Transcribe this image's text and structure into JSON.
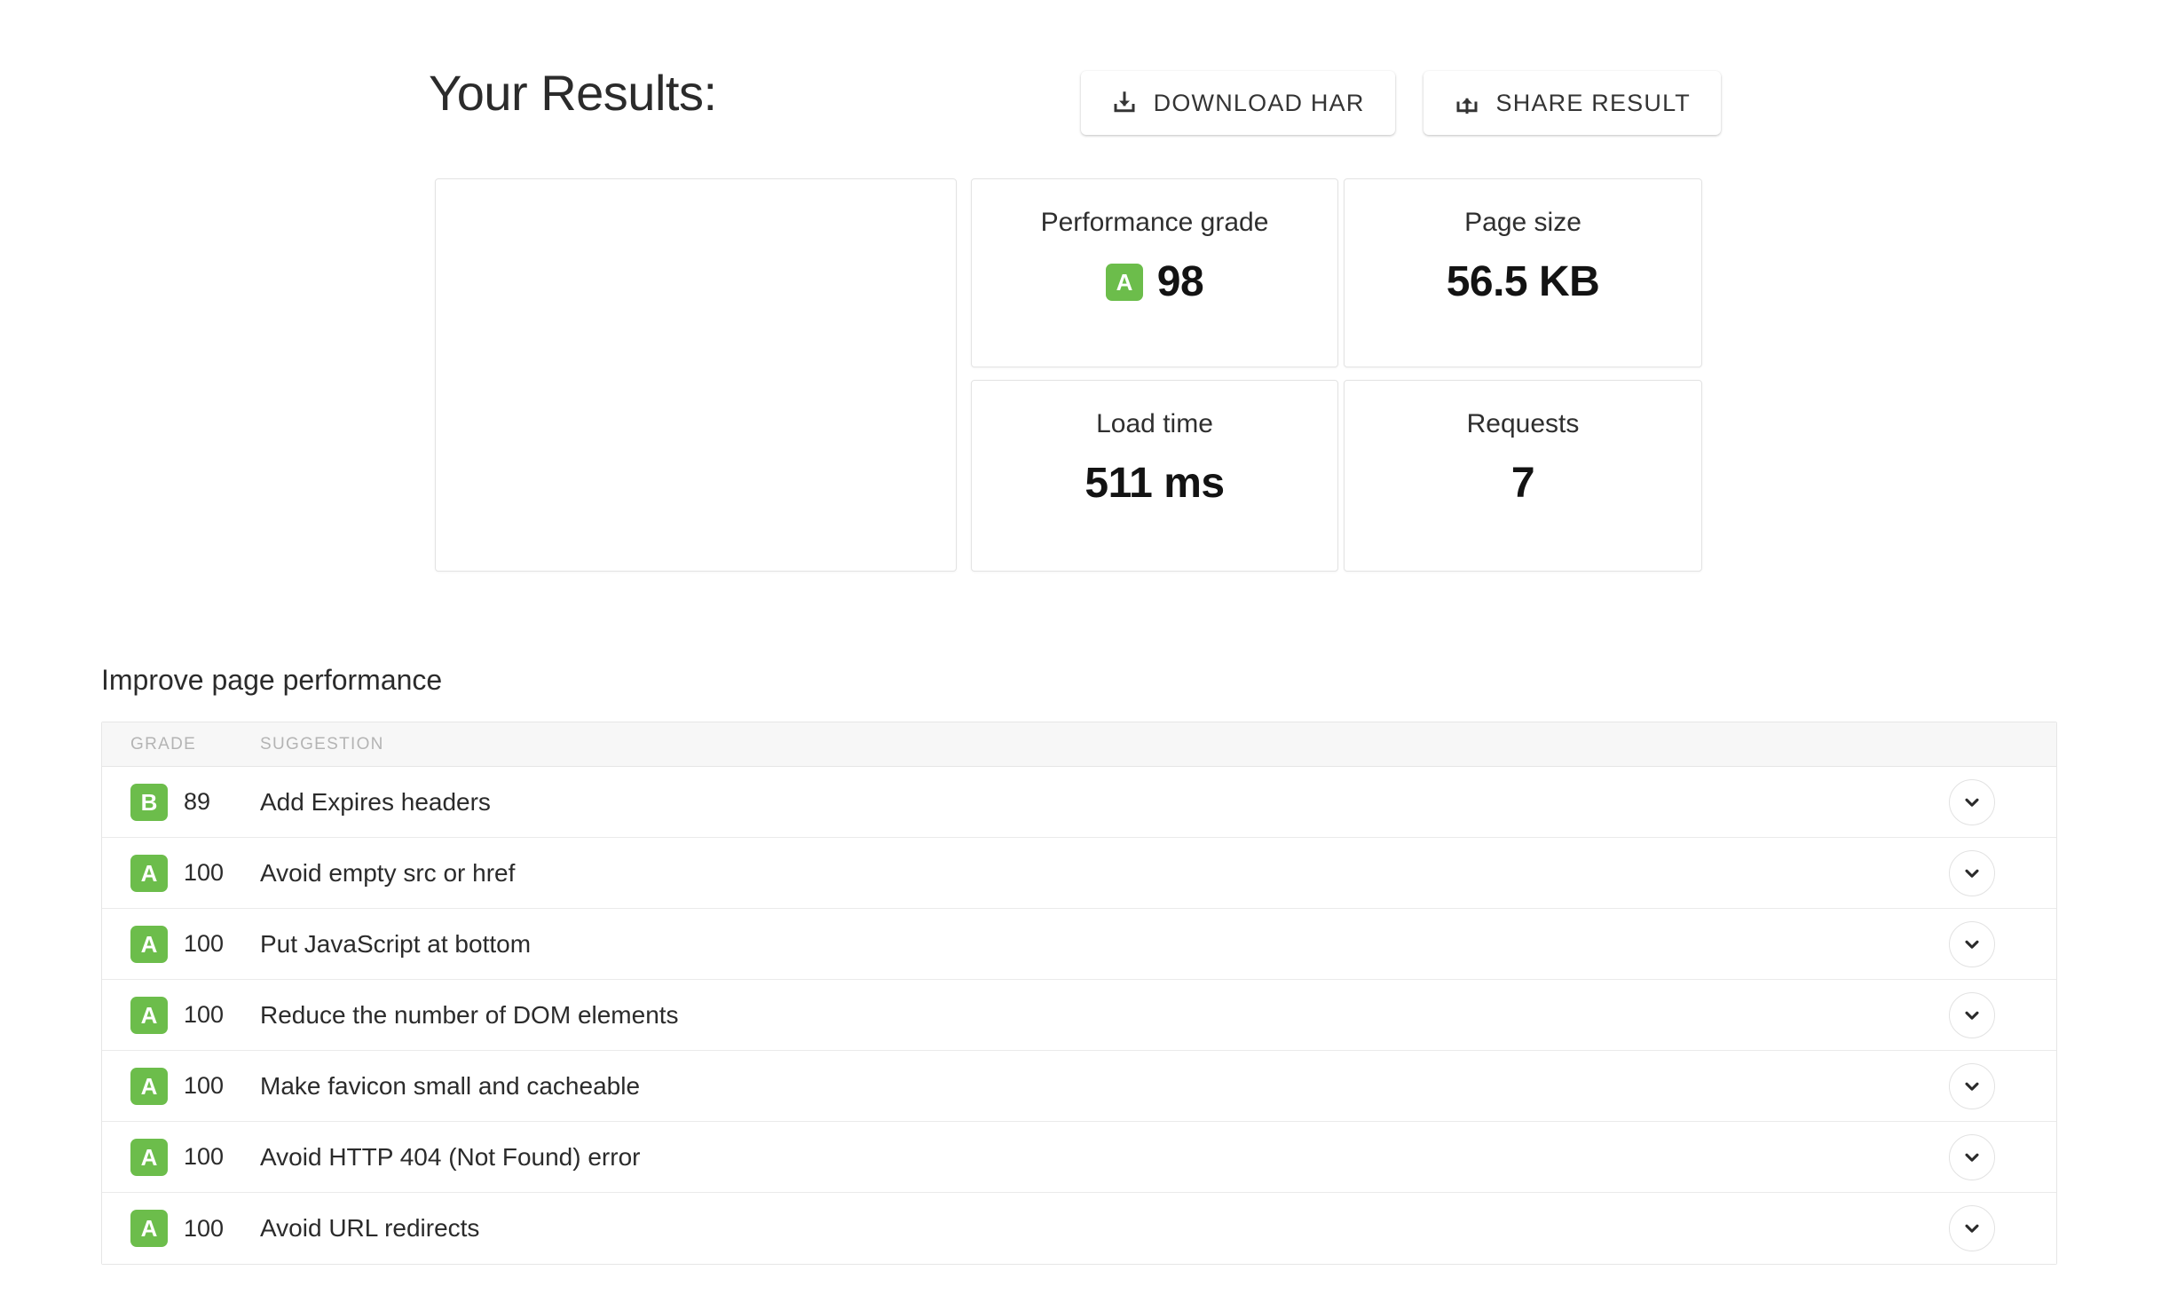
{
  "header": {
    "title": "Your Results:",
    "actions": [
      {
        "label": "DOWNLOAD HAR",
        "icon": "download-icon"
      },
      {
        "label": "SHARE RESULT",
        "icon": "share-icon"
      }
    ]
  },
  "cards": {
    "screenshot": {
      "name": "page-screenshot-card",
      "content": ""
    },
    "performance_grade": {
      "title": "Performance grade",
      "grade": "A",
      "value": "98"
    },
    "page_size": {
      "title": "Page size",
      "value": "56.5 KB"
    },
    "load_time": {
      "title": "Load time",
      "value": "511 ms"
    },
    "requests": {
      "title": "Requests",
      "value": "7"
    }
  },
  "improve": {
    "heading": "Improve page performance",
    "columns": {
      "grade": "GRADE",
      "suggestion": "SUGGESTION"
    },
    "rows": [
      {
        "grade": "B",
        "score": "89",
        "suggestion": "Add Expires headers"
      },
      {
        "grade": "A",
        "score": "100",
        "suggestion": "Avoid empty src or href"
      },
      {
        "grade": "A",
        "score": "100",
        "suggestion": "Put JavaScript at bottom"
      },
      {
        "grade": "A",
        "score": "100",
        "suggestion": "Reduce the number of DOM elements"
      },
      {
        "grade": "A",
        "score": "100",
        "suggestion": "Make favicon small and cacheable"
      },
      {
        "grade": "A",
        "score": "100",
        "suggestion": "Avoid HTTP 404 (Not Found) error"
      },
      {
        "grade": "A",
        "score": "100",
        "suggestion": "Avoid URL redirects"
      }
    ]
  },
  "colors": {
    "grade_green": "#6cbd4b",
    "text_primary": "#2b2b2b",
    "value_text": "#131313",
    "table_header_bg": "#f7f7f7",
    "table_header_text": "#b4b4b4",
    "border": "#e6e6e6",
    "page_bg": "#ffffff"
  }
}
